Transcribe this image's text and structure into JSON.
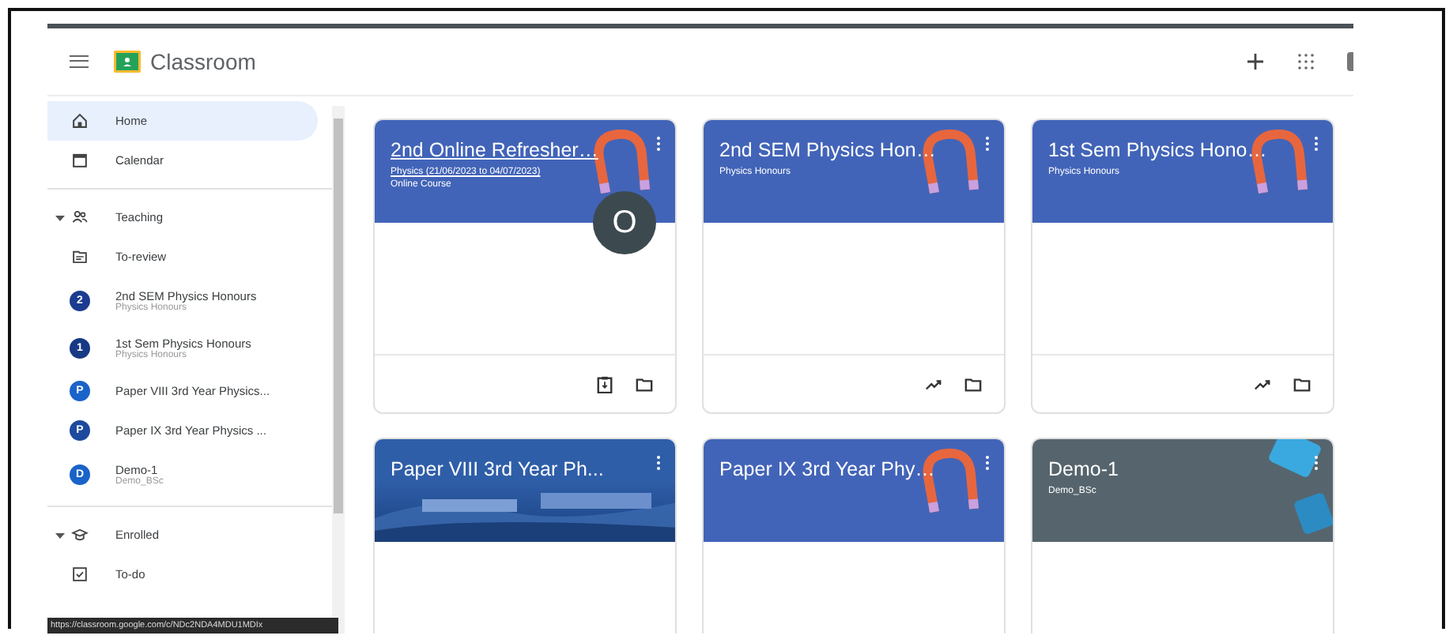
{
  "app": {
    "title": "Classroom"
  },
  "sidebar": {
    "items": [
      {
        "kind": "nav",
        "label": "Home",
        "selected": true
      },
      {
        "kind": "nav",
        "label": "Calendar",
        "selected": false
      },
      {
        "kind": "section",
        "label": "Teaching",
        "expanded": true,
        "children": [
          {
            "kind": "nav",
            "label": "To-review",
            "selected": false
          },
          {
            "kind": "class",
            "initial": "2",
            "color": "#1a3b8f",
            "label": "2nd SEM Physics Honours",
            "sublabel": "Physics Honours",
            "selected": false
          },
          {
            "kind": "class",
            "initial": "1",
            "color": "#173a85",
            "label": "1st Sem Physics Honours",
            "sublabel": "Physics Honours",
            "selected": false
          },
          {
            "kind": "class",
            "initial": "P",
            "color": "#1a63c9",
            "label": "Paper VIII 3rd Year Physics...",
            "selected": false
          },
          {
            "kind": "class",
            "initial": "P",
            "color": "#1d4a9e",
            "label": "Paper IX 3rd Year Physics ...",
            "selected": false
          },
          {
            "kind": "class",
            "initial": "D",
            "color": "#1a63c9",
            "label": "Demo-1",
            "sublabel": "Demo_BSc",
            "selected": false
          }
        ]
      },
      {
        "kind": "section",
        "label": "Enrolled",
        "expanded": true,
        "children": [
          {
            "kind": "nav",
            "label": "To-do",
            "selected": false
          }
        ]
      }
    ]
  },
  "status_bar": {
    "url": "https://classroom.google.com/c/NDc2NDA4MDU1MDIx"
  },
  "cards": [
    {
      "title": "2nd Online Refresher…",
      "subtitle": "Physics (21/06/2023 to 04/07/2023)",
      "section": "Online Course",
      "owner_initial": "O",
      "underlined": true
    },
    {
      "title": "2nd SEM Physics Hon…",
      "subtitle": "Physics Honours",
      "underlined": false
    },
    {
      "title": "1st Sem Physics Hono…",
      "subtitle": "Physics Honours",
      "underlined": false
    },
    {
      "title": "Paper VIII 3rd Year Ph...",
      "underlined": false
    },
    {
      "title": "Paper IX 3rd Year Phy…",
      "underlined": false
    },
    {
      "title": "Demo-1",
      "subtitle": "Demo_BSc",
      "underlined": false
    }
  ]
}
